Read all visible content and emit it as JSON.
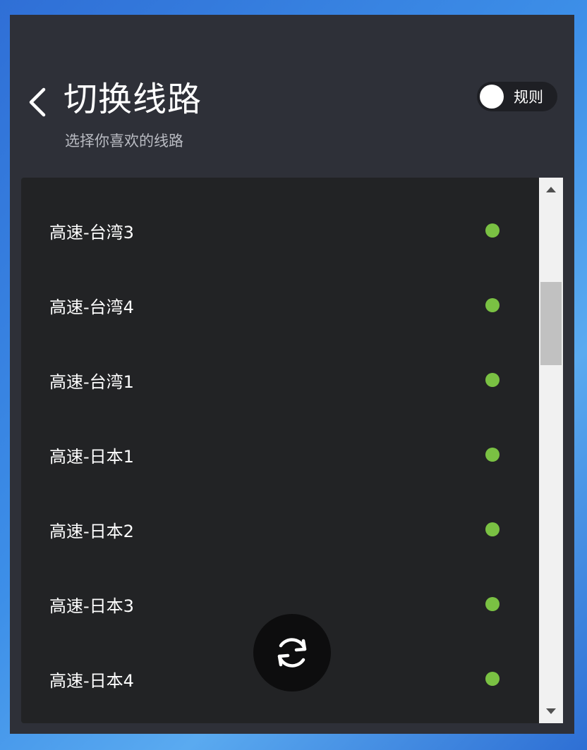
{
  "header": {
    "title": "切换线路",
    "subtitle": "选择你喜欢的线路"
  },
  "rule_toggle": {
    "label": "规则",
    "on": false
  },
  "colors": {
    "status_online": "#7ac143",
    "window_bg": "#2e3038",
    "list_bg": "#222325"
  },
  "icons": {
    "back": "chevron-left-icon",
    "refresh": "refresh-icon",
    "scroll_up": "triangle-up-icon",
    "scroll_down": "triangle-down-icon"
  },
  "lines": [
    {
      "name": "高速-台湾3",
      "status": "online"
    },
    {
      "name": "高速-台湾4",
      "status": "online"
    },
    {
      "name": "高速-台湾1",
      "status": "online"
    },
    {
      "name": "高速-日本1",
      "status": "online"
    },
    {
      "name": "高速-日本2",
      "status": "online"
    },
    {
      "name": "高速-日本3",
      "status": "online"
    },
    {
      "name": "高速-日本4",
      "status": "online"
    }
  ]
}
